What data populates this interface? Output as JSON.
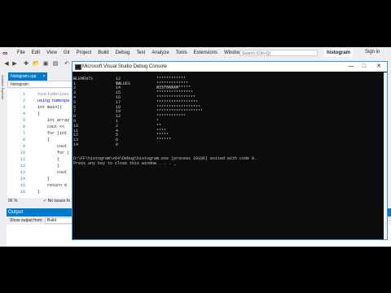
{
  "ide": {
    "menu": [
      "File",
      "Edit",
      "View",
      "Git",
      "Project",
      "Build",
      "Debug",
      "Test",
      "Analyze",
      "Tools",
      "Extensions",
      "Window",
      "Help"
    ],
    "search_placeholder": "Search (Ctrl+Q)",
    "solution_name": "histogram",
    "sign_in": "Sign in",
    "side_tab": "Solution Explorer",
    "doc_tab": "histogram.cpp",
    "doc_tab_close": "×",
    "nav_scope": "histogram",
    "line_numbers": [
      "1",
      "2",
      "3",
      "4",
      "5",
      "6",
      "7",
      "8",
      "9",
      "10",
      "11",
      "12",
      "13",
      "14",
      "15",
      "16"
    ],
    "code_lines": [
      {
        "cls": "pp",
        "text": "#include<iost"
      },
      {
        "cls": "kw",
        "text": "using namespa"
      },
      {
        "cls": "tx",
        "text": "int main()"
      },
      {
        "cls": "tx",
        "text": "{"
      },
      {
        "cls": "tx",
        "text": "    int array"
      },
      {
        "cls": "tx",
        "text": "    cout << "
      },
      {
        "cls": "tx",
        "text": "    for (int"
      },
      {
        "cls": "tx",
        "text": "    {"
      },
      {
        "cls": "tx",
        "text": "        cout"
      },
      {
        "cls": "tx",
        "text": "        for ("
      },
      {
        "cls": "tx",
        "text": "        {"
      },
      {
        "cls": "tx",
        "text": "        }"
      },
      {
        "cls": "tx",
        "text": "        cout"
      },
      {
        "cls": "tx",
        "text": "    }"
      },
      {
        "cls": "tx",
        "text": "    return 0"
      },
      {
        "cls": "tx",
        "text": "}"
      }
    ],
    "zoom": "96 %",
    "issues": "No issues fo",
    "output_title": "Output",
    "show_output_from": "Show output from:",
    "output_source": "Build"
  },
  "console": {
    "title": "Microsoft Visual Studio Debug Console",
    "headers": [
      "ELEMENTS",
      "VALUES",
      "HISTOGRAM"
    ],
    "rows": [
      {
        "e": "0",
        "v": "12",
        "h": "************"
      },
      {
        "e": "1",
        "v": "13",
        "h": "*************"
      },
      {
        "e": "2",
        "v": "14",
        "h": "**************"
      },
      {
        "e": "3",
        "v": "15",
        "h": "***************"
      },
      {
        "e": "4",
        "v": "16",
        "h": "****************"
      },
      {
        "e": "5",
        "v": "17",
        "h": "*****************"
      },
      {
        "e": "6",
        "v": "18",
        "h": "******************"
      },
      {
        "e": "7",
        "v": "19",
        "h": "*******************"
      },
      {
        "e": "8",
        "v": "12",
        "h": "************"
      },
      {
        "e": "9",
        "v": "1",
        "h": "*"
      },
      {
        "e": "10",
        "v": "2",
        "h": "**"
      },
      {
        "e": "11",
        "v": "4",
        "h": "****"
      },
      {
        "e": "12",
        "v": "5",
        "h": "*****"
      },
      {
        "e": "13",
        "v": "6",
        "h": "******"
      },
      {
        "e": "14",
        "v": "0",
        "h": ""
      }
    ],
    "exit_line": "D:\\FF\\histogram\\x64\\Debug\\histogram.exe (process 10336) exited with code 0.",
    "press_line": "Press any key to close this window . . ."
  }
}
